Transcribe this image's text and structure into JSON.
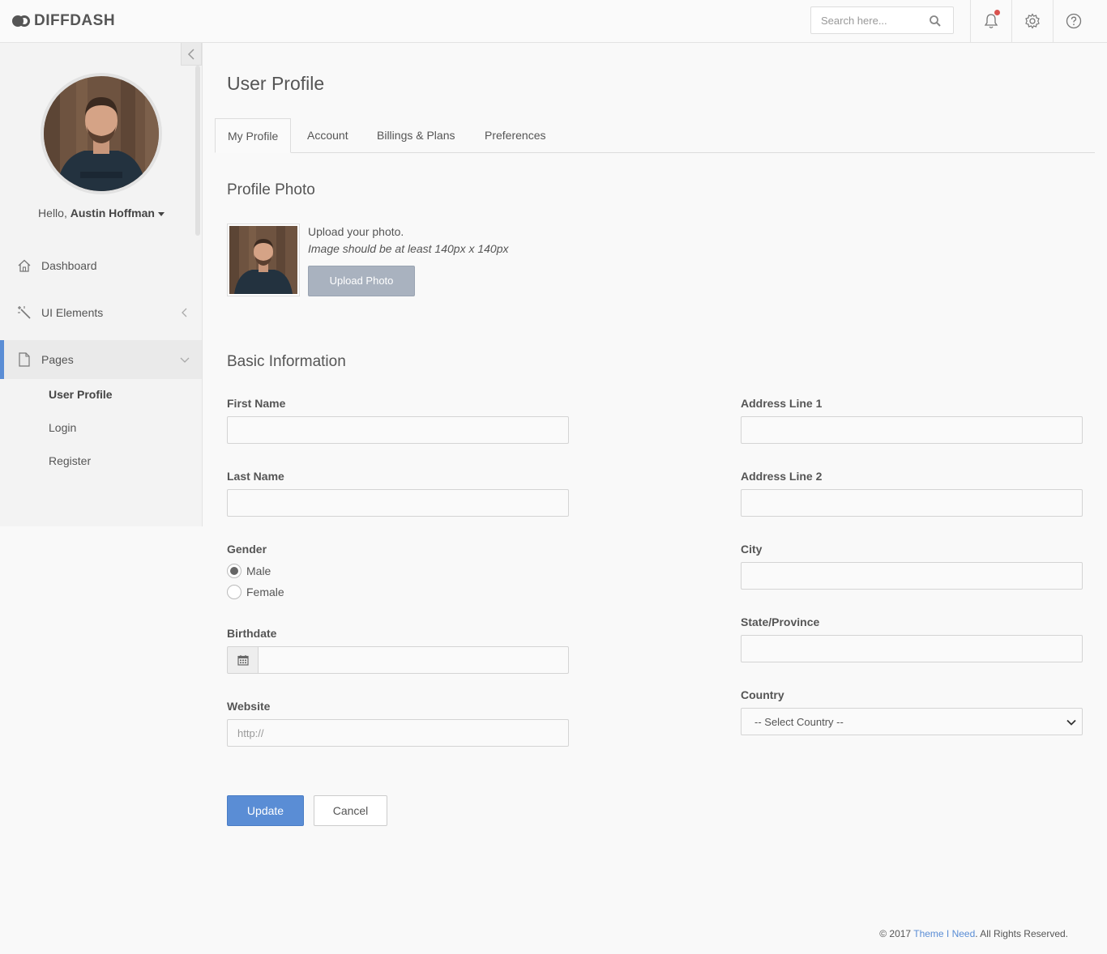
{
  "app": {
    "brand": "DIFFDASH",
    "accent_color": "#5a8dd5",
    "notification_dot_color": "#d9534f"
  },
  "topbar": {
    "search_placeholder": "Search here...",
    "icons": [
      "search-icon",
      "bell-icon",
      "gear-icon",
      "help-icon"
    ]
  },
  "sidebar": {
    "greeting": "Hello,",
    "user_name": "Austin Hoffman",
    "items": [
      {
        "label": "Dashboard",
        "icon": "home-icon"
      },
      {
        "label": "UI Elements",
        "icon": "magic-wand-icon"
      },
      {
        "label": "Pages",
        "icon": "page-icon"
      }
    ],
    "sub_items": [
      {
        "label": "User Profile"
      },
      {
        "label": "Login"
      },
      {
        "label": "Register"
      }
    ]
  },
  "main": {
    "page_title": "User Profile",
    "tabs": [
      {
        "label": "My Profile"
      },
      {
        "label": "Account"
      },
      {
        "label": "Billings & Plans"
      },
      {
        "label": "Preferences"
      }
    ],
    "profile_photo": {
      "title": "Profile Photo",
      "upload_text": "Upload your photo.",
      "hint": "Image should be at least 140px x 140px",
      "button": "Upload Photo"
    },
    "basic_info": {
      "title": "Basic Information",
      "first_name_label": "First Name",
      "first_name_value": "",
      "last_name_label": "Last Name",
      "last_name_value": "",
      "gender_label": "Gender",
      "gender_options": [
        "Male",
        "Female"
      ],
      "gender_selected": "Male",
      "birthdate_label": "Birthdate",
      "birthdate_value": "",
      "website_label": "Website",
      "website_placeholder": "http://",
      "address1_label": "Address Line 1",
      "address1_value": "",
      "address2_label": "Address Line 2",
      "address2_value": "",
      "city_label": "City",
      "city_value": "",
      "state_label": "State/Province",
      "state_value": "",
      "country_label": "Country",
      "country_selected": "-- Select Country --"
    },
    "buttons": {
      "update": "Update",
      "cancel": "Cancel"
    }
  },
  "footer": {
    "prefix": "© 2017 ",
    "link": "Theme I Need",
    "suffix": ". All Rights Reserved."
  }
}
